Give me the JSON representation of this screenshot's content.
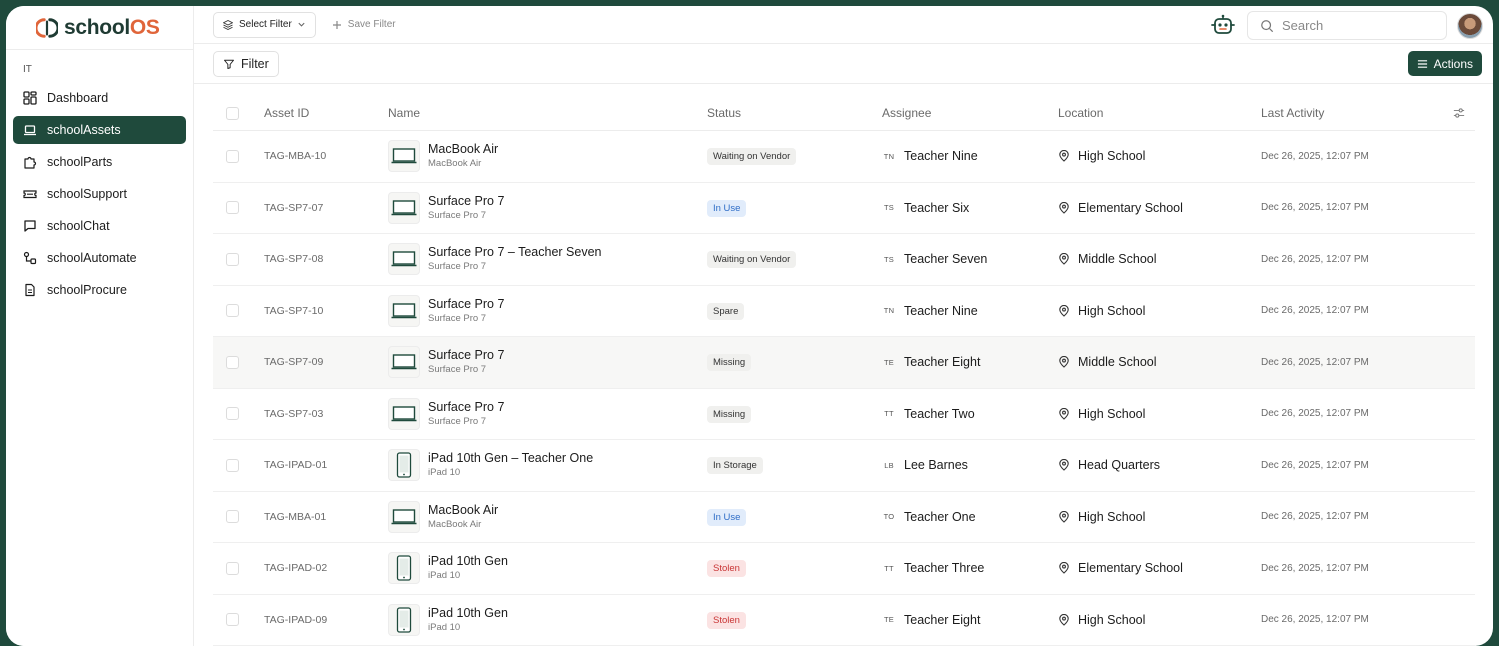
{
  "brand": {
    "name_prefix": "school",
    "name_suffix": "OS"
  },
  "sidebar": {
    "section": "IT",
    "items": [
      {
        "label": "Dashboard",
        "icon": "grid-icon",
        "active": false
      },
      {
        "label": "schoolAssets",
        "icon": "laptop-icon",
        "active": true
      },
      {
        "label": "schoolParts",
        "icon": "puzzle-icon",
        "active": false
      },
      {
        "label": "schoolSupport",
        "icon": "ticket-icon",
        "active": false
      },
      {
        "label": "schoolChat",
        "icon": "chat-icon",
        "active": false
      },
      {
        "label": "schoolAutomate",
        "icon": "workflow-icon",
        "active": false
      },
      {
        "label": "schoolProcure",
        "icon": "document-icon",
        "active": false
      }
    ]
  },
  "topbar": {
    "select_filter": "Select Filter",
    "save_filter": "Save Filter",
    "search_placeholder": "Search"
  },
  "toolbar": {
    "filter": "Filter",
    "actions": "Actions"
  },
  "table": {
    "headers": {
      "asset_id": "Asset ID",
      "name": "Name",
      "status": "Status",
      "assignee": "Assignee",
      "location": "Location",
      "last_activity": "Last Activity"
    },
    "rows": [
      {
        "asset_id": "TAG-MBA-10",
        "name": "MacBook Air",
        "model": "MacBook Air",
        "device": "laptop",
        "status": "Waiting on Vendor",
        "status_tone": "gray",
        "initials": "TN",
        "assignee": "Teacher Nine",
        "location": "High School",
        "last_activity": "Dec 26, 2025, 12:07 PM"
      },
      {
        "asset_id": "TAG-SP7-07",
        "name": "Surface Pro 7",
        "model": "Surface Pro 7",
        "device": "laptop",
        "status": "In Use",
        "status_tone": "blue",
        "initials": "TS",
        "assignee": "Teacher Six",
        "location": "Elementary School",
        "last_activity": "Dec 26, 2025, 12:07 PM"
      },
      {
        "asset_id": "TAG-SP7-08",
        "name": "Surface Pro 7 – Teacher Seven",
        "model": "Surface Pro 7",
        "device": "laptop",
        "status": "Waiting on Vendor",
        "status_tone": "gray",
        "initials": "TS",
        "assignee": "Teacher Seven",
        "location": "Middle School",
        "last_activity": "Dec 26, 2025, 12:07 PM"
      },
      {
        "asset_id": "TAG-SP7-10",
        "name": "Surface Pro 7",
        "model": "Surface Pro 7",
        "device": "laptop",
        "status": "Spare",
        "status_tone": "gray",
        "initials": "TN",
        "assignee": "Teacher Nine",
        "location": "High School",
        "last_activity": "Dec 26, 2025, 12:07 PM"
      },
      {
        "asset_id": "TAG-SP7-09",
        "name": "Surface Pro 7",
        "model": "Surface Pro 7",
        "device": "laptop",
        "status": "Missing",
        "status_tone": "gray",
        "initials": "TE",
        "assignee": "Teacher Eight",
        "location": "Middle School",
        "last_activity": "Dec 26, 2025, 12:07 PM",
        "hover": true
      },
      {
        "asset_id": "TAG-SP7-03",
        "name": "Surface Pro 7",
        "model": "Surface Pro 7",
        "device": "laptop",
        "status": "Missing",
        "status_tone": "gray",
        "initials": "TT",
        "assignee": "Teacher Two",
        "location": "High School",
        "last_activity": "Dec 26, 2025, 12:07 PM"
      },
      {
        "asset_id": "TAG-IPAD-01",
        "name": "iPad 10th Gen – Teacher One",
        "model": "iPad 10",
        "device": "tablet",
        "status": "In Storage",
        "status_tone": "gray",
        "initials": "LB",
        "assignee": "Lee Barnes",
        "location": "Head Quarters",
        "last_activity": "Dec 26, 2025, 12:07 PM"
      },
      {
        "asset_id": "TAG-MBA-01",
        "name": "MacBook Air",
        "model": "MacBook Air",
        "device": "laptop",
        "status": "In Use",
        "status_tone": "blue",
        "initials": "TO",
        "assignee": "Teacher One",
        "location": "High School",
        "last_activity": "Dec 26, 2025, 12:07 PM"
      },
      {
        "asset_id": "TAG-IPAD-02",
        "name": "iPad 10th Gen",
        "model": "iPad 10",
        "device": "tablet",
        "status": "Stolen",
        "status_tone": "red",
        "initials": "TT",
        "assignee": "Teacher Three",
        "location": "Elementary School",
        "last_activity": "Dec 26, 2025, 12:07 PM"
      },
      {
        "asset_id": "TAG-IPAD-09",
        "name": "iPad 10th Gen",
        "model": "iPad 10",
        "device": "tablet",
        "status": "Stolen",
        "status_tone": "red",
        "initials": "TE",
        "assignee": "Teacher Eight",
        "location": "High School",
        "last_activity": "Dec 26, 2025, 12:07 PM"
      }
    ]
  },
  "colors": {
    "brand_dark": "#1f4a3c",
    "brand_accent": "#e0653a",
    "badge_blue": "#2f6dc7",
    "badge_red": "#c93636"
  }
}
